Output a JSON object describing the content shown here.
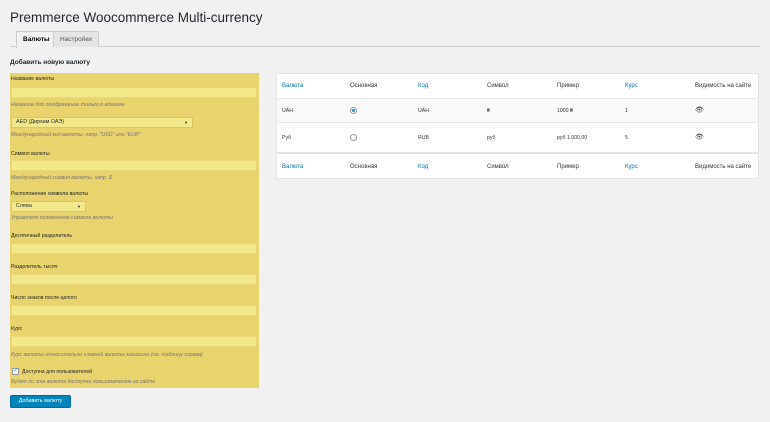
{
  "page": {
    "title": "Premmerce Woocommerce Multi-currency"
  },
  "tabs": [
    {
      "label": "Валюты"
    },
    {
      "label": "Настройки"
    }
  ],
  "form": {
    "section_title": "Добавить новую валюту",
    "name_label": "Название валюты",
    "name_value": "",
    "name_hint": "Название для отображение только в админке",
    "code_select": "AED (Дирхам ОАЭ)",
    "code_hint": "Международный код валюты, напр. \"USD\" или \"EUR\"",
    "symbol_label": "Символ валюты",
    "symbol_value": "",
    "symbol_hint": "Международный символ валюты, напр. $",
    "position_label": "Расположение символа валюты",
    "position_select": "Слева",
    "position_hint": "Управляет положением символа валюты",
    "decimal_label": "Десятичный разделитель",
    "decimal_value": "",
    "thousand_label": "Разделитель тысяч",
    "thousand_value": "",
    "decimals_label": "Число знаков после целого",
    "decimals_value": "",
    "rate_label": "Курс",
    "rate_value": "",
    "rate_hint": "Курс валюты относительно главной валюты магазина (см. таблицу справа)",
    "available_checked": true,
    "available_label": "Доступна для пользователей",
    "available_hint": "Будет ли эта валюта доступна пользователям на сайте",
    "submit_label": "Добавить валюту"
  },
  "table": {
    "columns": [
      "Валюта",
      "Основная",
      "Код",
      "Символ",
      "Пример",
      "Курс",
      "Видимость на сайте"
    ],
    "rows": [
      {
        "currency": "UAH",
        "main": true,
        "code": "UAH",
        "symbol": "₴",
        "example": "1000 ₴",
        "rate": "1",
        "visible_icon": "eye-icon"
      },
      {
        "currency": "Руб",
        "main": false,
        "code": "RUB",
        "symbol": "руб",
        "example": "руб 1.000,00",
        "rate": "5",
        "visible_icon": "eye-icon"
      }
    ]
  },
  "colors": {
    "highlight": "#e8d36c",
    "primary_button": "#0085ba",
    "link": "#0073aa"
  }
}
